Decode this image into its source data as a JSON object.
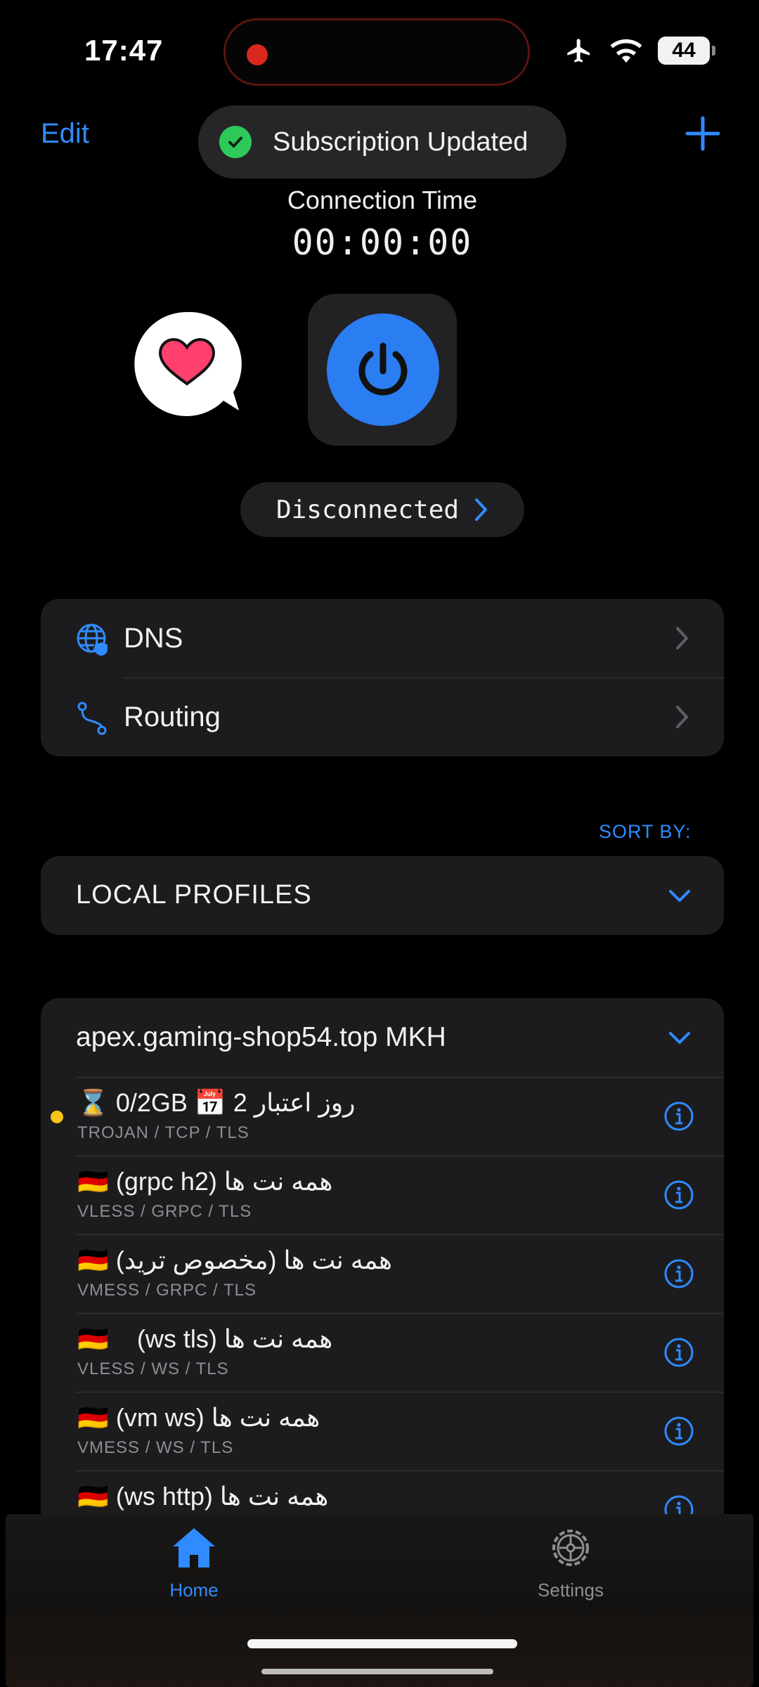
{
  "status_bar": {
    "time": "17:47",
    "battery": "44",
    "icons": [
      "airplane-icon",
      "wifi-icon",
      "battery-icon"
    ]
  },
  "nav": {
    "edit_label": "Edit",
    "add_icon": "plus-icon"
  },
  "toast": {
    "text": "Subscription Updated",
    "icon": "check-circle-icon"
  },
  "connection": {
    "label": "Connection Time",
    "timer": "00:00:00",
    "status": "Disconnected"
  },
  "menu": {
    "items": [
      {
        "label": "DNS",
        "icon": "globe-shield-icon"
      },
      {
        "label": "Routing",
        "icon": "route-icon"
      }
    ]
  },
  "sort_by_label": "SORT BY:",
  "local_profiles_label": "LOCAL PROFILES",
  "subscription": {
    "name": "apex.gaming-shop54.top  MKH",
    "profiles": [
      {
        "name": "⌛ 0/2GB 📅 2 روز اعتبار",
        "protocol": "TROJAN / TCP / TLS",
        "active": true
      },
      {
        "name": "🇩🇪 (grpc h2) همه نت ها",
        "protocol": "VLESS / GRPC / TLS",
        "active": false
      },
      {
        "name": "🇩🇪 (مخصوص ترید) همه نت ها",
        "protocol": "VMESS / GRPC / TLS",
        "active": false
      },
      {
        "name": "🇩🇪    (ws tls) همه نت ها",
        "protocol": "VLESS / WS / TLS",
        "active": false
      },
      {
        "name": "🇩🇪 (vm ws) همه نت ها",
        "protocol": "VMESS / WS / TLS",
        "active": false
      },
      {
        "name": "🇩🇪 (ws http) همه نت ها",
        "protocol": "",
        "active": false
      }
    ]
  },
  "tabs": [
    {
      "label": "Home",
      "icon": "house-icon",
      "active": true
    },
    {
      "label": "Settings",
      "icon": "gear-icon",
      "active": false
    }
  ],
  "colors": {
    "accent": "#2f8bff",
    "background": "#000000",
    "card": "#1c1c1e",
    "success": "#2fc95a",
    "active_dot": "#f5c518"
  }
}
